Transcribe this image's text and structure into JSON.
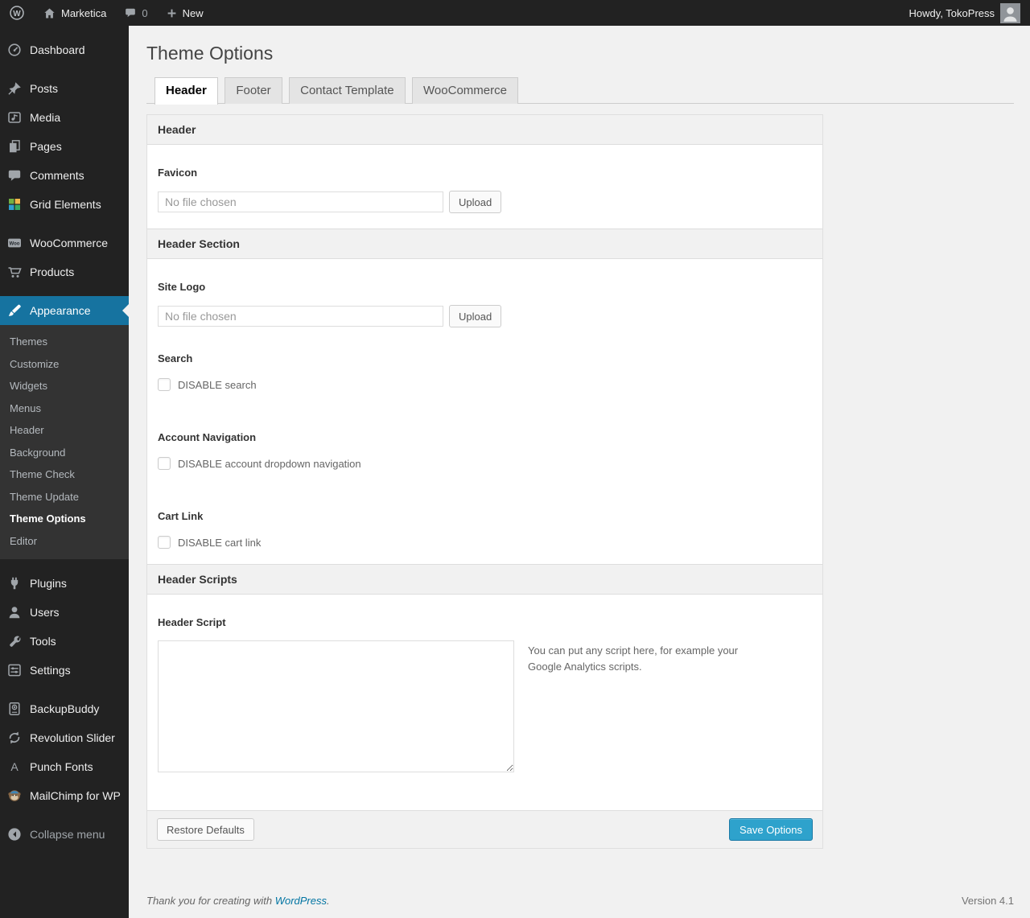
{
  "admin_bar": {
    "site_name": "Marketica",
    "comment_count": "0",
    "new_label": "New",
    "howdy_text": "Howdy, TokoPress"
  },
  "sidebar": {
    "items": [
      {
        "label": "Dashboard"
      },
      {
        "label": "Posts"
      },
      {
        "label": "Media"
      },
      {
        "label": "Pages"
      },
      {
        "label": "Comments"
      },
      {
        "label": "Grid Elements"
      },
      {
        "label": "WooCommerce"
      },
      {
        "label": "Products"
      },
      {
        "label": "Appearance"
      },
      {
        "label": "Plugins"
      },
      {
        "label": "Users"
      },
      {
        "label": "Tools"
      },
      {
        "label": "Settings"
      },
      {
        "label": "BackupBuddy"
      },
      {
        "label": "Revolution Slider"
      },
      {
        "label": "Punch Fonts"
      },
      {
        "label": "MailChimp for WP"
      }
    ],
    "appearance_submenu": [
      {
        "label": "Themes"
      },
      {
        "label": "Customize"
      },
      {
        "label": "Widgets"
      },
      {
        "label": "Menus"
      },
      {
        "label": "Header"
      },
      {
        "label": "Background"
      },
      {
        "label": "Theme Check"
      },
      {
        "label": "Theme Update"
      },
      {
        "label": "Theme Options",
        "current": true
      },
      {
        "label": "Editor"
      }
    ],
    "collapse_label": "Collapse menu"
  },
  "page": {
    "title": "Theme Options",
    "tabs": [
      {
        "label": "Header",
        "active": true
      },
      {
        "label": "Footer",
        "active": false
      },
      {
        "label": "Contact Template",
        "active": false
      },
      {
        "label": "WooCommerce",
        "active": false
      }
    ]
  },
  "panel": {
    "sections": {
      "header": "Header",
      "header_section": "Header Section",
      "header_scripts": "Header Scripts"
    },
    "favicon_label": "Favicon",
    "favicon_placeholder": "No file chosen",
    "favicon_upload": "Upload",
    "site_logo_label": "Site Logo",
    "site_logo_placeholder": "No file chosen",
    "site_logo_upload": "Upload",
    "search_label": "Search",
    "search_checkbox": "DISABLE search",
    "account_label": "Account Navigation",
    "account_checkbox": "DISABLE account dropdown navigation",
    "cart_label": "Cart Link",
    "cart_checkbox": "DISABLE cart link",
    "script_label": "Header Script",
    "script_value": "",
    "script_description": "You can put any script here, for example your Google Analytics scripts.",
    "restore_button": "Restore Defaults",
    "save_button": "Save Options"
  },
  "footer": {
    "thanks_prefix": "Thank you for creating with",
    "wordpress_link": "WordPress",
    "thanks_suffix": ".",
    "version": "Version 4.1"
  },
  "colors": {
    "admin_bar_bg": "#222222",
    "menu_highlight": "#1673a0",
    "primary_button": "#2ea2cc",
    "link": "#0074a2",
    "page_bg": "#f1f1f1"
  }
}
